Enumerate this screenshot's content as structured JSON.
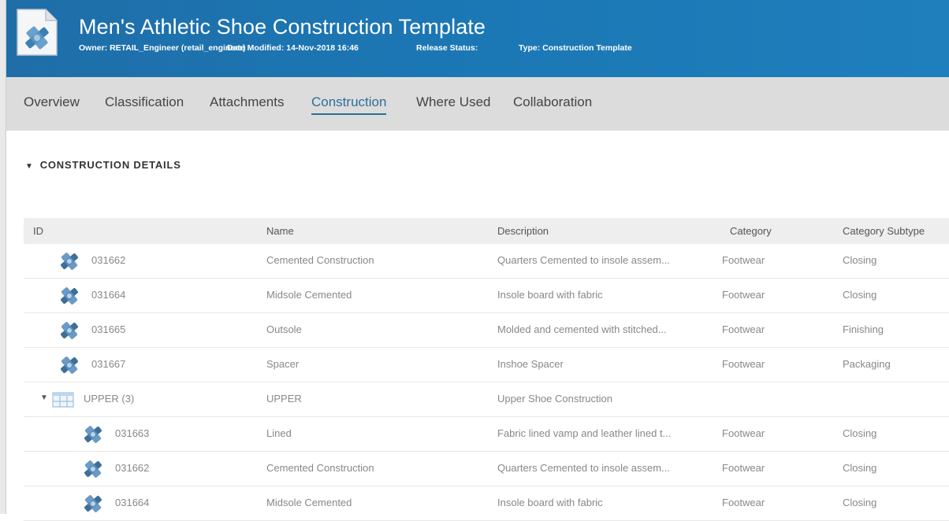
{
  "header": {
    "title": "Men's Athletic Shoe Construction Template",
    "owner": "Owner: RETAIL_Engineer (retail_engineer)",
    "date_modified": "Date Modified: 14-Nov-2018 16:46",
    "release_status": "Release Status:",
    "type": "Type: Construction Template"
  },
  "tabs": [
    {
      "label": "Overview",
      "active": false
    },
    {
      "label": "Classification",
      "active": false
    },
    {
      "label": "Attachments",
      "active": false
    },
    {
      "label": "Construction",
      "active": true
    },
    {
      "label": "Where Used",
      "active": false
    },
    {
      "label": "Collaboration",
      "active": false
    }
  ],
  "section": {
    "title": "CONSTRUCTION DETAILS"
  },
  "table": {
    "columns": [
      "ID",
      "Name",
      "Description",
      "Category",
      "Category Subtype"
    ],
    "rows": [
      {
        "id": "031662",
        "name": "Cemented Construction",
        "description": "Quarters Cemented to insole assem...",
        "category": "Footwear",
        "subtype": "Closing",
        "type": "item",
        "level": 0
      },
      {
        "id": "031664",
        "name": "Midsole Cemented",
        "description": "Insole board with fabric",
        "category": "Footwear",
        "subtype": "Closing",
        "type": "item",
        "level": 0
      },
      {
        "id": "031665",
        "name": "Outsole",
        "description": "Molded and cemented with stitched...",
        "category": "Footwear",
        "subtype": "Finishing",
        "type": "item",
        "level": 0
      },
      {
        "id": "031667",
        "name": "Spacer",
        "description": "Inshoe Spacer",
        "category": "Footwear",
        "subtype": "Packaging",
        "type": "item",
        "level": 0
      },
      {
        "id": "UPPER (3)",
        "name": "UPPER",
        "description": "Upper Shoe Construction",
        "category": "",
        "subtype": "",
        "type": "group",
        "level": 0
      },
      {
        "id": "031663",
        "name": "Lined",
        "description": "Fabric lined vamp and leather lined t...",
        "category": "Footwear",
        "subtype": "Closing",
        "type": "item",
        "level": 1
      },
      {
        "id": "031662",
        "name": "Cemented Construction",
        "description": "Quarters Cemented to insole assem...",
        "category": "Footwear",
        "subtype": "Closing",
        "type": "item",
        "level": 1
      },
      {
        "id": "031664",
        "name": "Midsole Cemented",
        "description": "Insole board with fabric",
        "category": "Footwear",
        "subtype": "Closing",
        "type": "item",
        "level": 1
      }
    ]
  },
  "colors": {
    "header_bg": "#1b77b4",
    "tab_bar_bg": "#dcdcdc",
    "active_tab": "#2b6f9a",
    "table_header_bg": "#eeeeee"
  },
  "icons": {
    "app": "construction-template-icon",
    "item": "construction-item-icon",
    "group": "folder-group-icon",
    "expand": "caret-down-icon"
  }
}
